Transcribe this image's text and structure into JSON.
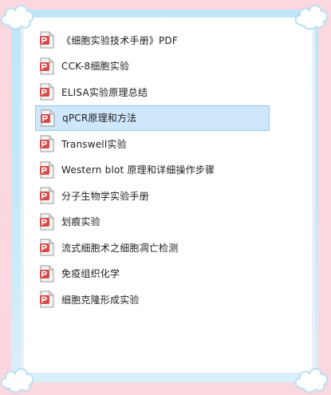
{
  "files": [
    {
      "name": "《细胞实验技术手册》PDF",
      "selected": false
    },
    {
      "name": "CCK-8细胞实验",
      "selected": false
    },
    {
      "name": "ELISA实验原理总结",
      "selected": false
    },
    {
      "name": "qPCR原理和方法",
      "selected": true
    },
    {
      "name": "Transwell实验",
      "selected": false
    },
    {
      "name": "Western blot 原理和详细操作步骤",
      "selected": false
    },
    {
      "name": "分子生物学实验手册",
      "selected": false
    },
    {
      "name": "划痕实验",
      "selected": false
    },
    {
      "name": "流式细胞术之细胞凋亡检测",
      "selected": false
    },
    {
      "name": "免疫组织化学",
      "selected": false
    },
    {
      "name": "细胞克隆形成实验",
      "selected": false
    }
  ],
  "colors": {
    "background": "#fbd7df",
    "frame": "#c9e9f8",
    "selection": "#cfe7fb",
    "icon_accent": "#d64a4a"
  },
  "icon": "file-document-icon"
}
